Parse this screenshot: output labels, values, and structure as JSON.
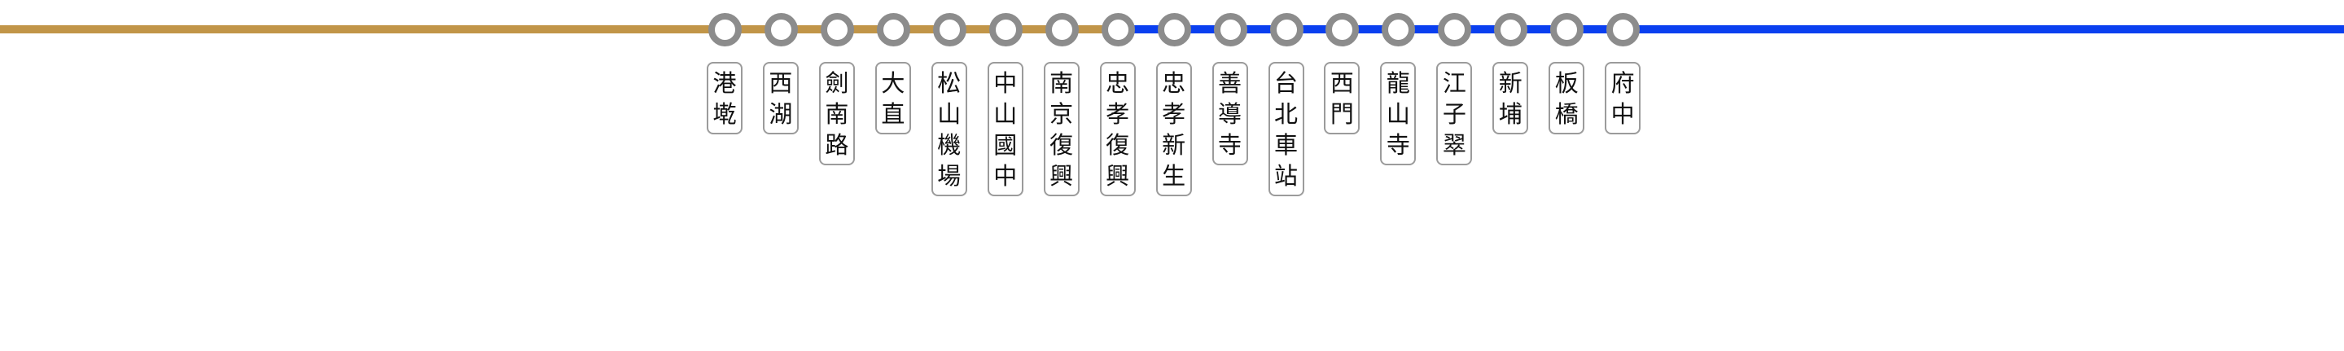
{
  "line_colors": {
    "segment_1": "#c19548",
    "segment_2": "#0a3ff0"
  },
  "stations": [
    {
      "name": "港墘"
    },
    {
      "name": "西湖"
    },
    {
      "name": "劍南路"
    },
    {
      "name": "大直"
    },
    {
      "name": "松山機場"
    },
    {
      "name": "中山國中"
    },
    {
      "name": "南京復興"
    },
    {
      "name": "忠孝復興"
    },
    {
      "name": "忠孝新生"
    },
    {
      "name": "善導寺"
    },
    {
      "name": "台北車站"
    },
    {
      "name": "西門"
    },
    {
      "name": "龍山寺"
    },
    {
      "name": "江子翠"
    },
    {
      "name": "新埔"
    },
    {
      "name": "板橋"
    },
    {
      "name": "府中"
    }
  ]
}
